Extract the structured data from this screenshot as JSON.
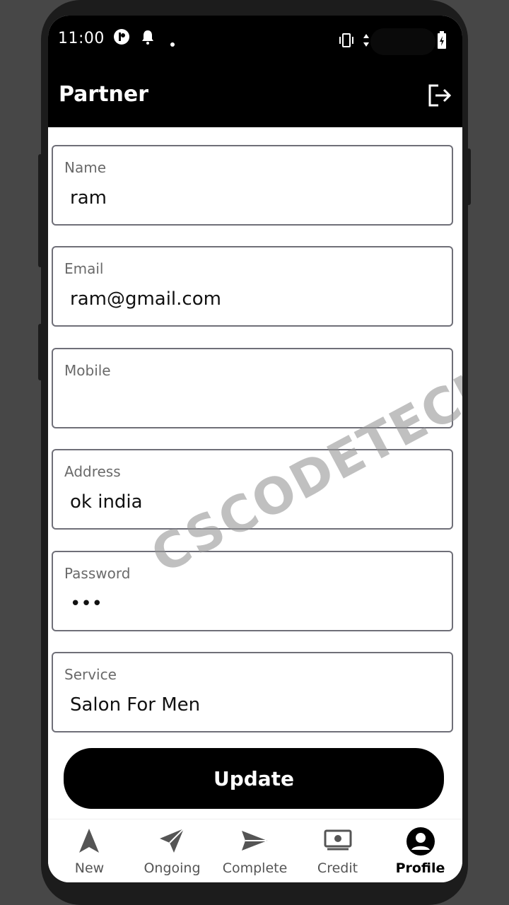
{
  "status_bar": {
    "time": "11:00"
  },
  "app_bar": {
    "title": "Partner"
  },
  "form": {
    "fields": [
      {
        "label": "Name",
        "value": "ram"
      },
      {
        "label": "Email",
        "value": "ram@gmail.com"
      },
      {
        "label": "Mobile",
        "value": ""
      },
      {
        "label": "Address",
        "value": "ok india"
      },
      {
        "label": "Password",
        "value": "•••"
      },
      {
        "label": "Service",
        "value": "Salon For Men"
      }
    ],
    "update_label": "Update"
  },
  "bottom_nav": {
    "items": [
      {
        "label": "New",
        "icon": "navigation-arrow-icon"
      },
      {
        "label": "Ongoing",
        "icon": "send-icon"
      },
      {
        "label": "Complete",
        "icon": "send-right-icon"
      },
      {
        "label": "Credit",
        "icon": "money-icon"
      },
      {
        "label": "Profile",
        "icon": "account-circle-icon",
        "active": true
      }
    ]
  },
  "watermark": "CSCODETECH"
}
